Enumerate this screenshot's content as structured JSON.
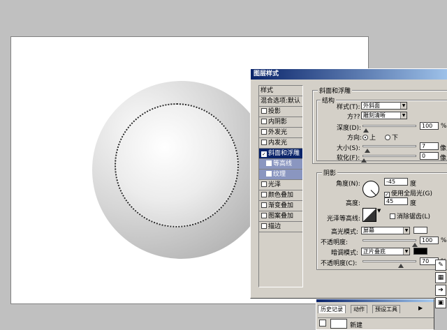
{
  "dialog": {
    "title": "图层样式",
    "left_items": [
      {
        "label": "样式",
        "kind": "head"
      },
      {
        "label": "混合选项:默认",
        "kind": "head"
      },
      {
        "label": "投影",
        "checked": false
      },
      {
        "label": "内阴影",
        "checked": false
      },
      {
        "label": "外发光",
        "checked": false
      },
      {
        "label": "内发光",
        "checked": false
      },
      {
        "label": "斜面和浮雕",
        "checked": true,
        "selected": true
      },
      {
        "label": "等高线",
        "checked": false,
        "sub": true
      },
      {
        "label": "纹理",
        "checked": false,
        "sub": true
      },
      {
        "label": "光泽",
        "checked": false
      },
      {
        "label": "颜色叠加",
        "checked": false
      },
      {
        "label": "渐变叠加",
        "checked": false
      },
      {
        "label": "图案叠加",
        "checked": false
      },
      {
        "label": "描边",
        "checked": false
      }
    ],
    "bevel": {
      "group_title": "斜面和浮雕",
      "structure_title": "结构",
      "style_label": "样式(T):",
      "style_value": "外斜面",
      "method_label": "方??",
      "method_value": "雕刻清晰",
      "depth_label": "深度(D):",
      "depth_value": "100",
      "direction_label": "方向:",
      "dir_up": "上",
      "dir_down": "下",
      "size_label": "大小(S):",
      "size_value": "7",
      "soften_label": "软化(F):",
      "soften_value": "0",
      "unit_percent": "%",
      "unit_px": "像素"
    },
    "shading": {
      "title": "阴影",
      "angle_label": "角度(N):",
      "angle_value": "-45",
      "degree": "度",
      "global_light": "使用全局光(G)",
      "altitude_label": "高度:",
      "altitude_value": "45",
      "gloss_label": "光泽等高线:",
      "anti_alias": "消除锯齿(L)",
      "highlight_mode_label": "高光模式:",
      "highlight_mode_value": "屏幕",
      "highlight_opacity_label": "不透明度:",
      "highlight_opacity_value": "100",
      "shadow_mode_label": "暗调模式:",
      "shadow_mode_value": "正片叠底",
      "shadow_opacity_label": "不透明度(C):",
      "shadow_opacity_value": "70",
      "highlight_color": "#ffffff",
      "shadow_color": "#000000"
    }
  },
  "history_panel": {
    "tabs": [
      "历史记录",
      "动作",
      "预设工具"
    ],
    "row_label": "新建"
  },
  "colors": {
    "title_start": "#0a246a",
    "workspace": "#c0c0c0",
    "dialog_face": "#d4d0c8"
  }
}
